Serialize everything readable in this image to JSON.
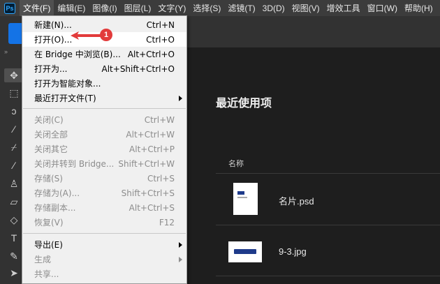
{
  "menubar": {
    "logo": "Ps",
    "items": [
      "文件(F)",
      "编辑(E)",
      "图像(I)",
      "图层(L)",
      "文字(Y)",
      "选择(S)",
      "滤镜(T)",
      "3D(D)",
      "视图(V)",
      "增效工具",
      "窗口(W)",
      "帮助(H)"
    ]
  },
  "file_menu": {
    "items": [
      {
        "label": "新建(N)...",
        "shortcut": "Ctrl+N"
      },
      {
        "label": "打开(O)...",
        "shortcut": "Ctrl+O"
      },
      {
        "label": "在 Bridge 中浏览(B)...",
        "shortcut": "Alt+Ctrl+O"
      },
      {
        "label": "打开为...",
        "shortcut": "Alt+Shift+Ctrl+O"
      },
      {
        "label": "打开为智能对象...",
        "shortcut": ""
      },
      {
        "label": "最近打开文件(T)",
        "shortcut": ""
      },
      {
        "label": "关闭(C)",
        "shortcut": "Ctrl+W"
      },
      {
        "label": "关闭全部",
        "shortcut": "Alt+Ctrl+W"
      },
      {
        "label": "关闭其它",
        "shortcut": "Alt+Ctrl+P"
      },
      {
        "label": "关闭并转到 Bridge...",
        "shortcut": "Shift+Ctrl+W"
      },
      {
        "label": "存储(S)",
        "shortcut": "Ctrl+S"
      },
      {
        "label": "存储为(A)...",
        "shortcut": "Shift+Ctrl+S"
      },
      {
        "label": "存储副本...",
        "shortcut": "Alt+Ctrl+S"
      },
      {
        "label": "恢复(V)",
        "shortcut": "F12"
      },
      {
        "label": "导出(E)",
        "shortcut": ""
      },
      {
        "label": "生成",
        "shortcut": ""
      },
      {
        "label": "共享...",
        "shortcut": ""
      }
    ]
  },
  "annotation": {
    "badge": "1",
    "color": "#e23b3b"
  },
  "home": {
    "recent_title": "最近使用项",
    "column_name": "名称",
    "files": [
      {
        "name": "名片.psd"
      },
      {
        "name": "9-3.jpg"
      }
    ]
  },
  "colors": {
    "accent": "#1473e6",
    "menubar": "#3c3c3c",
    "panel": "#323232",
    "canvas": "#1e1e1e"
  }
}
